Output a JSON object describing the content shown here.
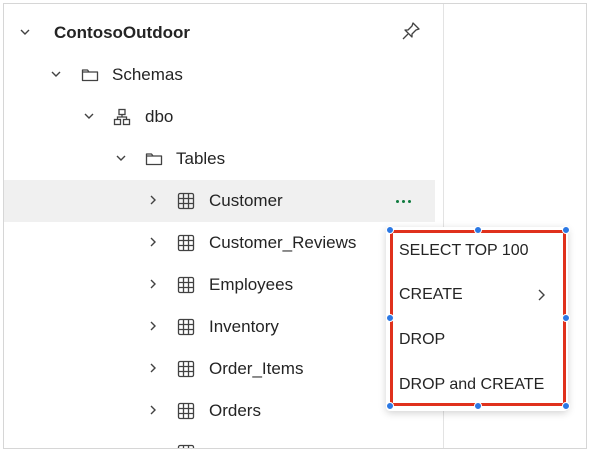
{
  "tree": {
    "nodes": [
      {
        "label": "ContosoOutdoor",
        "icon": "chevron-down-icon"
      },
      {
        "label": "Schemas",
        "icon": "folder-icon"
      },
      {
        "label": "dbo",
        "icon": "schema-icon"
      },
      {
        "label": "Tables",
        "icon": "folder-icon"
      },
      {
        "label": "Customer",
        "icon": "table-icon"
      },
      {
        "label": "Customer_Reviews",
        "icon": "table-icon"
      },
      {
        "label": "Employees",
        "icon": "table-icon"
      },
      {
        "label": "Inventory",
        "icon": "table-icon"
      },
      {
        "label": "Order_Items",
        "icon": "table-icon"
      },
      {
        "label": "Orders",
        "icon": "table-icon"
      }
    ]
  },
  "context_menu": {
    "items": [
      {
        "label": "SELECT TOP 100"
      },
      {
        "label": "CREATE"
      },
      {
        "label": "DROP"
      },
      {
        "label": "DROP and CREATE"
      }
    ]
  },
  "colors": {
    "selection_bg": "#f0f0f0",
    "more_dots": "#0f7b3f",
    "highlight_border": "#e0311c",
    "handle": "#2b78e4"
  }
}
